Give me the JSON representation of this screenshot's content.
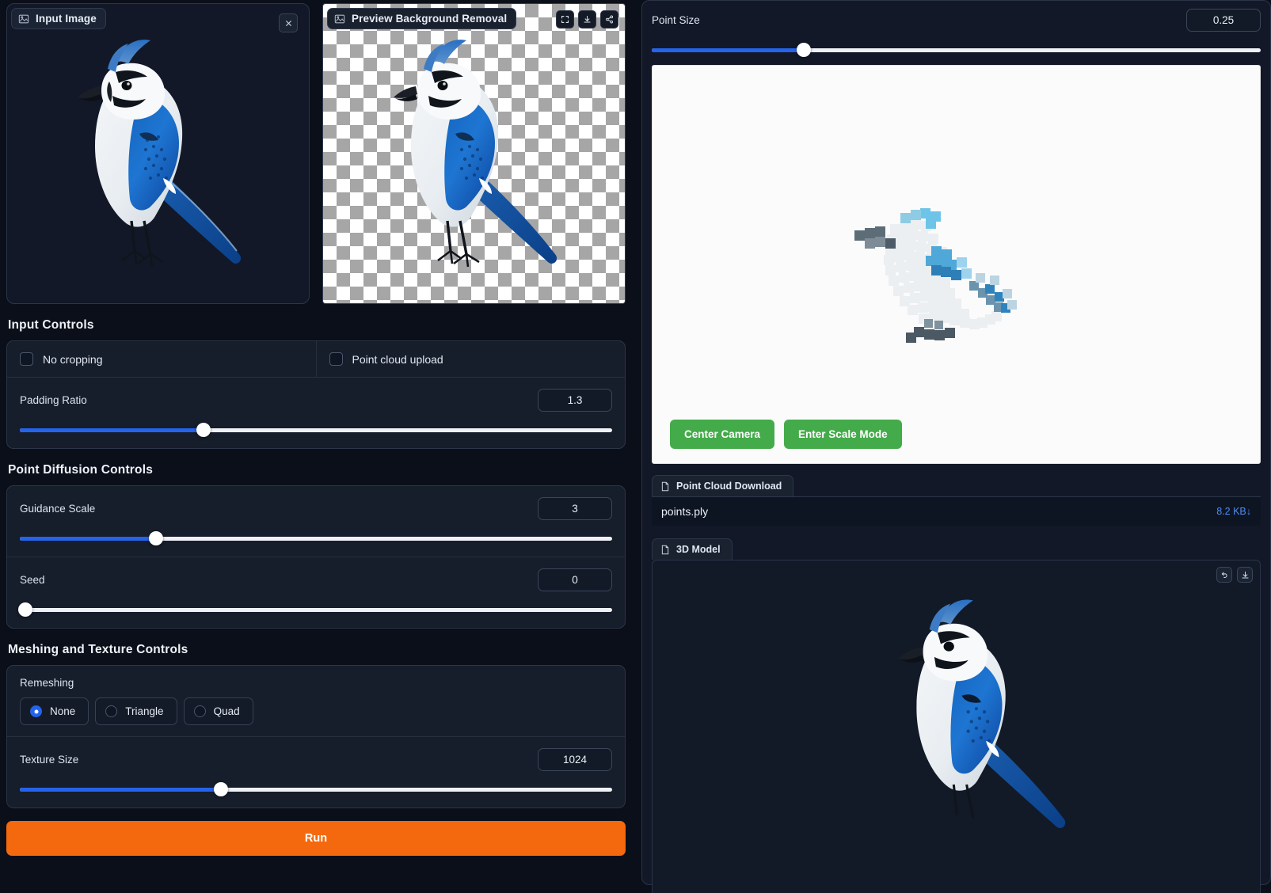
{
  "input_panel": {
    "tab_label": "Input Image",
    "tab_icon": "image-icon",
    "close_icon": "close-icon"
  },
  "preview_panel": {
    "tab_label": "Preview Background Removal",
    "tab_icon": "image-icon",
    "tools": [
      {
        "name": "fullscreen-icon",
        "label": "Fullscreen"
      },
      {
        "name": "download-icon",
        "label": "Download"
      },
      {
        "name": "share-icon",
        "label": "Share"
      }
    ]
  },
  "input_controls": {
    "title": "Input Controls",
    "checkboxes": [
      {
        "label": "No cropping",
        "checked": false
      },
      {
        "label": "Point cloud upload",
        "checked": false
      }
    ],
    "padding_ratio": {
      "label": "Padding Ratio",
      "value": "1.3",
      "percent": 31
    }
  },
  "point_diffusion_controls": {
    "title": "Point Diffusion Controls",
    "guidance_scale": {
      "label": "Guidance Scale",
      "value": "3",
      "percent": 23
    },
    "seed": {
      "label": "Seed",
      "value": "0",
      "percent": 1
    }
  },
  "meshing_controls": {
    "title": "Meshing and Texture Controls",
    "remeshing": {
      "label": "Remeshing",
      "options": [
        {
          "label": "None",
          "selected": true
        },
        {
          "label": "Triangle",
          "selected": false
        },
        {
          "label": "Quad",
          "selected": false
        }
      ]
    },
    "texture_size": {
      "label": "Texture Size",
      "value": "1024",
      "percent": 34
    }
  },
  "run": {
    "label": "Run"
  },
  "right_panel": {
    "point_size": {
      "label": "Point Size",
      "value": "0.25",
      "percent": 25
    },
    "viewer_buttons": [
      {
        "label": "Center Camera",
        "name": "center-camera-button"
      },
      {
        "label": "Enter Scale Mode",
        "name": "enter-scale-mode-button"
      }
    ],
    "point_cloud_download": {
      "tab_label": "Point Cloud Download",
      "tab_icon": "file-icon",
      "file_name": "points.ply",
      "file_size": "8.2 KB",
      "download_glyph": "↓"
    },
    "model_panel": {
      "tab_label": "3D Model",
      "tab_icon": "file-icon",
      "tools": [
        {
          "name": "undo-icon",
          "label": "Reset"
        },
        {
          "name": "download-icon",
          "label": "Download"
        }
      ]
    }
  },
  "colors": {
    "accent_blue": "#2563eb",
    "run_orange": "#f4690d",
    "green": "#44ab4a",
    "link_blue": "#4d8cf5",
    "bg": "#0b0f19"
  }
}
